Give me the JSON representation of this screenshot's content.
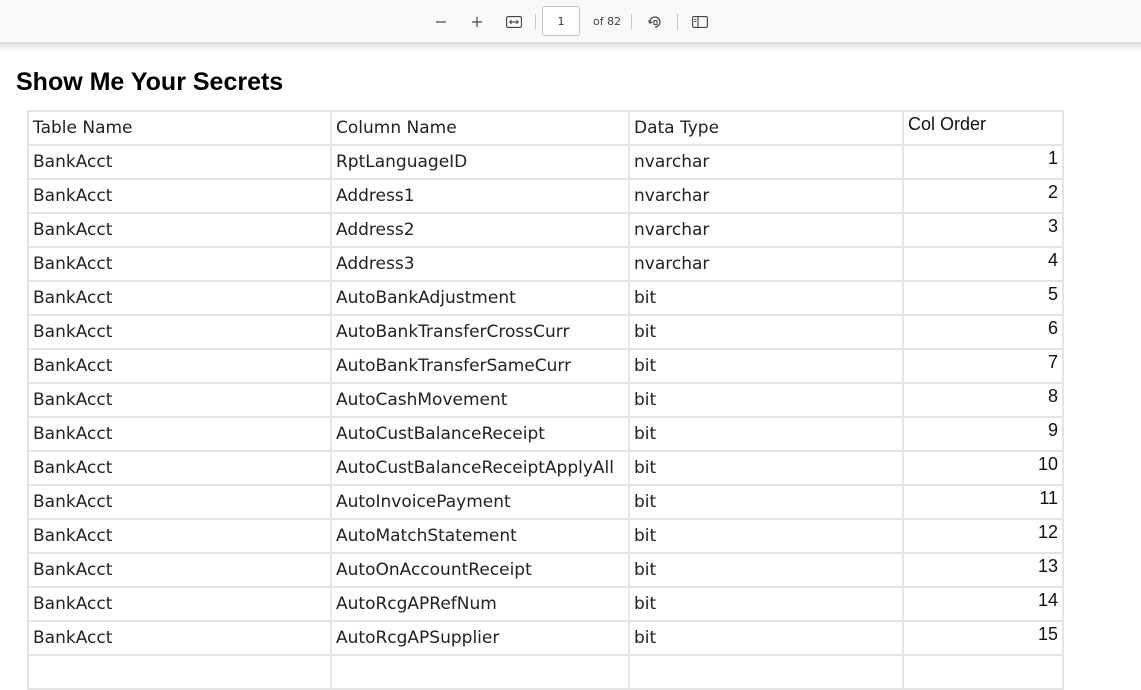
{
  "viewer": {
    "current_page": "1",
    "page_total": "of 82"
  },
  "document": {
    "title": "Show Me Your Secrets",
    "headers": {
      "table_name": "Table Name",
      "column_name": "Column Name",
      "data_type": "Data Type",
      "col_order": "Col Order"
    },
    "rows": [
      {
        "table": "BankAcct",
        "column": "RptLanguageID",
        "type": "nvarchar",
        "order": "1"
      },
      {
        "table": "BankAcct",
        "column": "Address1",
        "type": "nvarchar",
        "order": "2"
      },
      {
        "table": "BankAcct",
        "column": "Address2",
        "type": "nvarchar",
        "order": "3"
      },
      {
        "table": "BankAcct",
        "column": "Address3",
        "type": "nvarchar",
        "order": "4"
      },
      {
        "table": "BankAcct",
        "column": "AutoBankAdjustment",
        "type": "bit",
        "order": "5"
      },
      {
        "table": "BankAcct",
        "column": "AutoBankTransferCrossCurr",
        "type": "bit",
        "order": "6"
      },
      {
        "table": "BankAcct",
        "column": "AutoBankTransferSameCurr",
        "type": "bit",
        "order": "7"
      },
      {
        "table": "BankAcct",
        "column": "AutoCashMovement",
        "type": "bit",
        "order": "8"
      },
      {
        "table": "BankAcct",
        "column": "AutoCustBalanceReceipt",
        "type": "bit",
        "order": "9"
      },
      {
        "table": "BankAcct",
        "column": "AutoCustBalanceReceiptApplyAll",
        "type": "bit",
        "order": "10"
      },
      {
        "table": "BankAcct",
        "column": "AutoInvoicePayment",
        "type": "bit",
        "order": "11"
      },
      {
        "table": "BankAcct",
        "column": "AutoMatchStatement",
        "type": "bit",
        "order": "12"
      },
      {
        "table": "BankAcct",
        "column": "AutoOnAccountReceipt",
        "type": "bit",
        "order": "13"
      },
      {
        "table": "BankAcct",
        "column": "AutoRcgAPRefNum",
        "type": "bit",
        "order": "14"
      },
      {
        "table": "BankAcct",
        "column": "AutoRcgAPSupplier",
        "type": "bit",
        "order": "15"
      },
      {
        "table": "",
        "column": "",
        "type": "",
        "order": ""
      }
    ]
  }
}
